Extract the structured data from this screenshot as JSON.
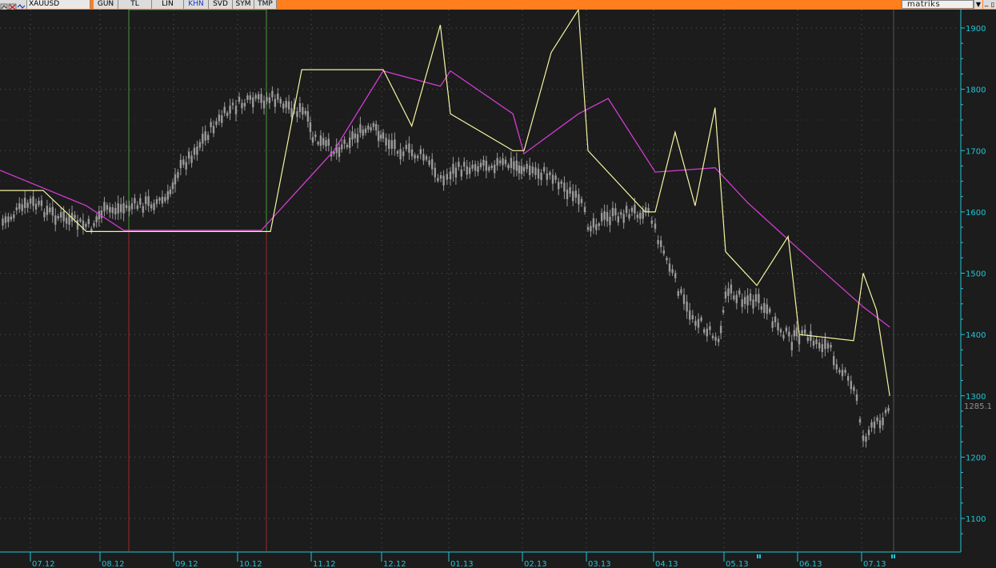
{
  "toolbar": {
    "symbol": "XAUUSD",
    "buttons": [
      "GUN",
      "TL",
      "LIN",
      "KHN",
      "SVD",
      "SYM",
      "TMP"
    ],
    "active_button": "KHN",
    "brand": "matriks",
    "dropdown_icon": "chevron-down-icon",
    "minimize_icon": "minimize-icon",
    "maximize_icon": "maximize-icon"
  },
  "colors": {
    "background": "#1c1c1c",
    "grid": "#5a5a5a",
    "axis_text": "#1fc6d8",
    "price_bars": "#9a9a9a",
    "yellow_line": "#f4f4a0",
    "magenta_line": "#d23cd2",
    "green_rect": "#4a9a3a",
    "red_vlines": "#a02828",
    "toolbar": "#ff7f1e"
  },
  "chart_data": {
    "type": "line",
    "y_axis_side": "right",
    "ylim": [
      1050,
      1925
    ],
    "y_ticks": [
      1100,
      1200,
      1300,
      1400,
      1500,
      1600,
      1700,
      1800,
      1900
    ],
    "x_ticks": [
      "07.12",
      "08.12",
      "09.12",
      "10.12",
      "11.12",
      "12.12",
      "01.13",
      "02.13",
      "03.13",
      "04.13",
      "05.13",
      "06.13",
      "07.13"
    ],
    "last_price_label": "1285.1",
    "last_price": 1285.1,
    "grid": true,
    "series": [
      {
        "role": "price",
        "style": "candlestick",
        "points": [
          [
            "07.12",
            1580
          ],
          [
            "07.12",
            1615
          ],
          [
            "07.12",
            1590
          ],
          [
            "07.12",
            1575
          ],
          [
            "08.12",
            1600
          ],
          [
            "08.12",
            1610
          ],
          [
            "08.12",
            1620
          ],
          [
            "09.12",
            1660
          ],
          [
            "09.12",
            1700
          ],
          [
            "09.12",
            1740
          ],
          [
            "09.12",
            1770
          ],
          [
            "10.12",
            1775
          ],
          [
            "10.12",
            1785
          ],
          [
            "10.12",
            1760
          ],
          [
            "11.12",
            1720
          ],
          [
            "11.12",
            1700
          ],
          [
            "11.12",
            1725
          ],
          [
            "11.12",
            1735
          ],
          [
            "12.12",
            1720
          ],
          [
            "12.12",
            1700
          ],
          [
            "12.12",
            1690
          ],
          [
            "12.12",
            1650
          ],
          [
            "01.13",
            1665
          ],
          [
            "01.13",
            1680
          ],
          [
            "01.13",
            1675
          ],
          [
            "02.13",
            1670
          ],
          [
            "02.13",
            1660
          ],
          [
            "02.13",
            1610
          ],
          [
            "03.13",
            1580
          ],
          [
            "03.13",
            1595
          ],
          [
            "03.13",
            1605
          ],
          [
            "04.13",
            1570
          ],
          [
            "04.13",
            1440
          ],
          [
            "04.13",
            1390
          ],
          [
            "05.13",
            1470
          ],
          [
            "05.13",
            1450
          ],
          [
            "05.13",
            1390
          ],
          [
            "06.13",
            1400
          ],
          [
            "06.13",
            1380
          ],
          [
            "06.13",
            1300
          ],
          [
            "07.13",
            1230
          ],
          [
            "07.13",
            1255
          ],
          [
            "07.13",
            1285
          ]
        ]
      },
      {
        "role": "yellow",
        "points": [
          [
            "07.12",
            1635
          ],
          [
            "07.12",
            1635
          ],
          [
            "07.12",
            1568
          ],
          [
            "08.12",
            1568
          ],
          [
            "08.12",
            1568
          ],
          [
            "09.12",
            1568
          ],
          [
            "10.12",
            1568
          ],
          [
            "10.12",
            1568
          ],
          [
            "10.12",
            1832
          ],
          [
            "11.12",
            1832
          ],
          [
            "11.12",
            1832
          ],
          [
            "12.12",
            1832
          ],
          [
            "12.12",
            1740
          ],
          [
            "12.12",
            1905
          ],
          [
            "01.13",
            1760
          ],
          [
            "01.13",
            1700
          ],
          [
            "02.13",
            1700
          ],
          [
            "02.13",
            1860
          ],
          [
            "02.13",
            1930
          ],
          [
            "03.13",
            1700
          ],
          [
            "03.13",
            1600
          ],
          [
            "04.13",
            1600
          ],
          [
            "04.13",
            1730
          ],
          [
            "04.13",
            1610
          ],
          [
            "04.13",
            1770
          ],
          [
            "05.13",
            1535
          ],
          [
            "05.13",
            1480
          ],
          [
            "05.13",
            1560
          ],
          [
            "06.13",
            1400
          ],
          [
            "06.13",
            1390
          ],
          [
            "07.13",
            1500
          ],
          [
            "07.13",
            1440
          ],
          [
            "07.13",
            1300
          ]
        ]
      },
      {
        "role": "magenta",
        "points": [
          [
            "07.12",
            1668
          ],
          [
            "07.12",
            1610
          ],
          [
            "08.12",
            1570
          ],
          [
            "10.12",
            1570
          ],
          [
            "11.12",
            1700
          ],
          [
            "12.12",
            1830
          ],
          [
            "12.12",
            1805
          ],
          [
            "01.13",
            1830
          ],
          [
            "01.13",
            1760
          ],
          [
            "02.13",
            1695
          ],
          [
            "02.13",
            1760
          ],
          [
            "03.13",
            1785
          ],
          [
            "04.13",
            1665
          ],
          [
            "04.13",
            1672
          ],
          [
            "05.13",
            1615
          ],
          [
            "06.13",
            1510
          ],
          [
            "07.13",
            1445
          ],
          [
            "07.13",
            1412
          ]
        ]
      }
    ]
  }
}
